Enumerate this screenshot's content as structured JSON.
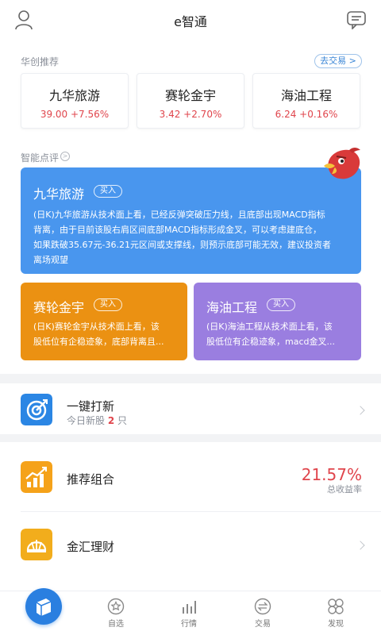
{
  "header": {
    "title": "e智通",
    "user_icon": "user-icon",
    "message_icon": "message-icon"
  },
  "recommend": {
    "title": "华创推荐",
    "trade_button": "去交易 >",
    "stocks": [
      {
        "name": "九华旅游",
        "price_change": "39.00 +7.56%"
      },
      {
        "name": "赛轮金宇",
        "price_change": "3.42 +2.70%"
      },
      {
        "name": "海油工程",
        "price_change": "6.24 +0.16%"
      }
    ]
  },
  "smart_review": {
    "title": "智能点评",
    "info_icon": "info-circle-icon",
    "cards": [
      {
        "name": "九华旅游",
        "tag": "买入",
        "lines": [
          "(日K)九华旅游从技术面上看，已经反弹突破压力线，且底部出现MACD指标",
          "背离，由于目前该股右肩区间底部MACD指标形成金叉，可以考虑建底仓，",
          "如果跌破35.67元-36.21元区间或支撑线，则预示底部可能无效，建议投资者",
          "离场观望"
        ],
        "color": "#4996ee"
      },
      {
        "name": "赛轮金宇",
        "tag": "买入",
        "lines": [
          "(日K)赛轮金宇从技术面上看，该",
          "股低位有企稳迹象，底部背离且..."
        ],
        "color": "#eb9112"
      },
      {
        "name": "海油工程",
        "tag": "买入",
        "lines": [
          "(日K)海油工程从技术面上看，该",
          "股低位有企稳迹象，macd金叉..."
        ],
        "color": "#9a7ee0"
      }
    ]
  },
  "features": {
    "ipo": {
      "title": "一键打新",
      "sub_prefix": "今日新股",
      "count": "2",
      "sub_suffix": "只"
    },
    "portfolio": {
      "title": "推荐组合",
      "rate": "21.57%",
      "rate_label": "总收益率"
    },
    "wealth": {
      "title": "金汇理财"
    }
  },
  "bottom_nav": {
    "items": [
      {
        "label": "自选",
        "icon": "star-icon"
      },
      {
        "label": "行情",
        "icon": "chart-icon"
      },
      {
        "label": "交易",
        "icon": "trade-icon"
      },
      {
        "label": "发现",
        "icon": "discover-icon"
      }
    ]
  },
  "colors": {
    "accent": "#2a7fe0",
    "up": "#e0454c",
    "muted": "#8a8f99"
  }
}
